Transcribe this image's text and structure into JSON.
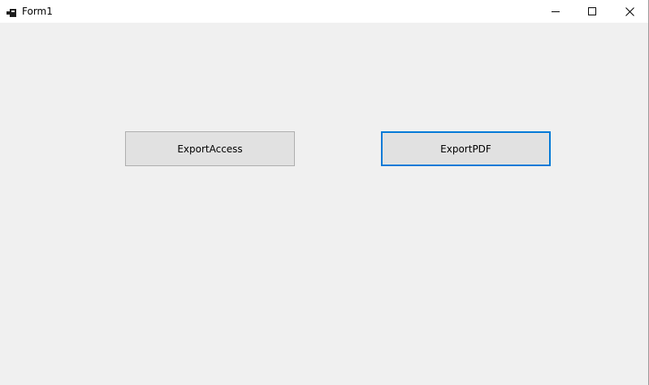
{
  "window": {
    "title": "Form1",
    "app_icon": "winforms-app-icon",
    "controls": {
      "minimize_icon": "minimize-icon",
      "maximize_icon": "maximize-icon",
      "close_icon": "close-icon"
    }
  },
  "form": {
    "buttons": [
      {
        "label": "ExportAccess",
        "focused": false
      },
      {
        "label": "ExportPDF",
        "focused": true
      }
    ]
  },
  "colors": {
    "form_background": "#f0f0f0",
    "titlebar_background": "#ffffff",
    "button_face": "#e1e1e1",
    "button_border": "#adadad",
    "focus_accent": "#0078d7"
  }
}
